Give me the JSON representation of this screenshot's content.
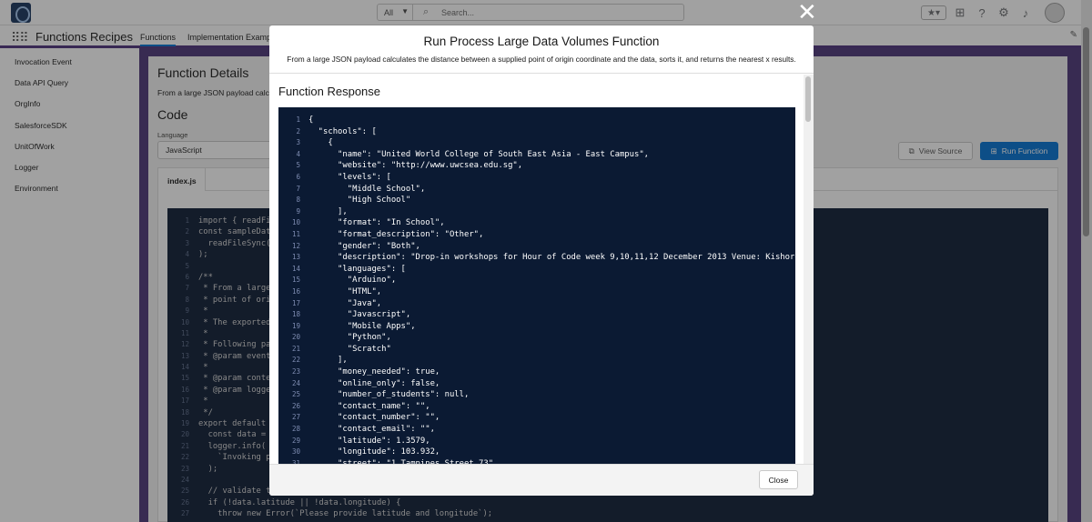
{
  "global_header": {
    "search_scope": "All",
    "search_placeholder": "Search...",
    "icons": [
      "favorites-star-icon",
      "global-actions-icon",
      "help-icon",
      "setup-gear-icon",
      "notifications-bell-icon",
      "avatar"
    ]
  },
  "app": {
    "name": "Functions Recipes",
    "tabs": [
      "Functions",
      "Implementation Exampl"
    ]
  },
  "sidebar": {
    "items": [
      "Invocation Event",
      "Data API Query",
      "OrgInfo",
      "SalesforceSDK",
      "UnitOfWork",
      "Logger",
      "Environment"
    ]
  },
  "details": {
    "title": "Function Details",
    "description": "From a large JSON payload calc",
    "code_heading": "Code",
    "language_label": "Language",
    "language_value": "JavaScript",
    "view_source": "View Source",
    "run_function": "Run Function",
    "file_tab": "index.js",
    "code_lines": [
      "import { readFi",
      "const sampleDat",
      "  readFileSync(",
      ");",
      "",
      "/**",
      " * From a large",
      " * point of ori",
      " *",
      " * The exported",
      " *",
      " * Following pa",
      " * @param event",
      " *",
      " * @param conte",
      " * @param logge",
      " *",
      " */",
      "export default",
      "  const data = ",
      "  logger.info(",
      "    `Invoking p",
      "  );",
      "",
      "  // validate the payload params",
      "  if (!data.latitude || !data.longitude) {",
      "    throw new Error(`Please provide latitude and longitude`);"
    ]
  },
  "modal": {
    "title": "Run Process Large Data Volumes Function",
    "tagline": "From a large JSON payload calculates the distance between a supplied point of origin coordinate and the data, sorts it, and returns the nearest x results.",
    "section_heading": "Function Response",
    "close_label": "Close",
    "response_lines": [
      "{",
      "  \"schools\": [",
      "    {",
      "      \"name\": \"United World College of South East Asia - East Campus\",",
      "      \"website\": \"http://www.uwcsea.edu.sg\",",
      "      \"levels\": [",
      "        \"Middle School\",",
      "        \"High School\"",
      "      ],",
      "      \"format\": \"In School\",",
      "      \"format_description\": \"Other\",",
      "      \"gender\": \"Both\",",
      "      \"description\": \"Drop-in workshops for Hour of Code week 9,10,11,12 December 2013 Venue: Kishore",
      "      \"languages\": [",
      "        \"Arduino\",",
      "        \"HTML\",",
      "        \"Java\",",
      "        \"Javascript\",",
      "        \"Mobile Apps\",",
      "        \"Python\",",
      "        \"Scratch\"",
      "      ],",
      "      \"money_needed\": true,",
      "      \"online_only\": false,",
      "      \"number_of_students\": null,",
      "      \"contact_name\": \"\",",
      "      \"contact_number\": \"\",",
      "      \"contact_email\": \"\",",
      "      \"latitude\": 1.3579,",
      "      \"longitude\": 103.932,",
      "      \"street\": \"1 Tampines Street 73\","
    ]
  },
  "colors": {
    "code_bg": "#0b1a33",
    "accent": "#0070d2",
    "stage": "#4a3578"
  }
}
